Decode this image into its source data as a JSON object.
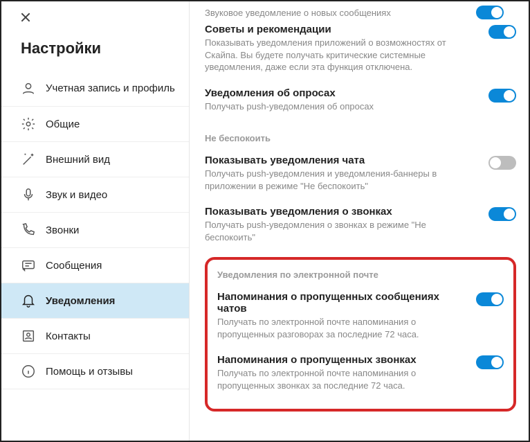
{
  "page_title": "Настройки",
  "sidebar": {
    "items": [
      {
        "label": "Учетная запись и профиль"
      },
      {
        "label": "Общие"
      },
      {
        "label": "Внешний вид"
      },
      {
        "label": "Звук и видео"
      },
      {
        "label": "Звонки"
      },
      {
        "label": "Сообщения"
      },
      {
        "label": "Уведомления"
      },
      {
        "label": "Контакты"
      },
      {
        "label": "Помощь и отзывы"
      }
    ]
  },
  "main": {
    "top_cut_desc": "Звуковое уведомление о новых сообщениях",
    "rows": [
      {
        "title": "Советы и рекомендации",
        "desc": "Показывать уведомления приложений о возможностях от Скайпа. Вы будете получать критические системные уведомления, даже если эта функция отключена.",
        "on": true
      },
      {
        "title": "Уведомления об опросах",
        "desc": "Получать push-уведомления об опросах",
        "on": true
      }
    ],
    "dnd_label": "Не беспокоить",
    "dnd_rows": [
      {
        "title": "Показывать уведомления чата",
        "desc": "Получать push-уведомления и уведомления-баннеры в приложении в режиме \"Не беспокоить\"",
        "on": false
      },
      {
        "title": "Показывать уведомления о звонках",
        "desc": "Получать push-уведомления о звонках в режиме \"Не беспокоить\"",
        "on": true
      }
    ],
    "email_label": "Уведомления по электронной почте",
    "email_rows": [
      {
        "title": "Напоминания о пропущенных сообщениях чатов",
        "desc": "Получать по электронной почте напоминания о пропущенных разговорах за последние 72 часа.",
        "on": true
      },
      {
        "title": "Напоминания о пропущенных звонках",
        "desc": "Получать по электронной почте напоминания о пропущенных звонках за последние 72 часа.",
        "on": true
      }
    ]
  }
}
